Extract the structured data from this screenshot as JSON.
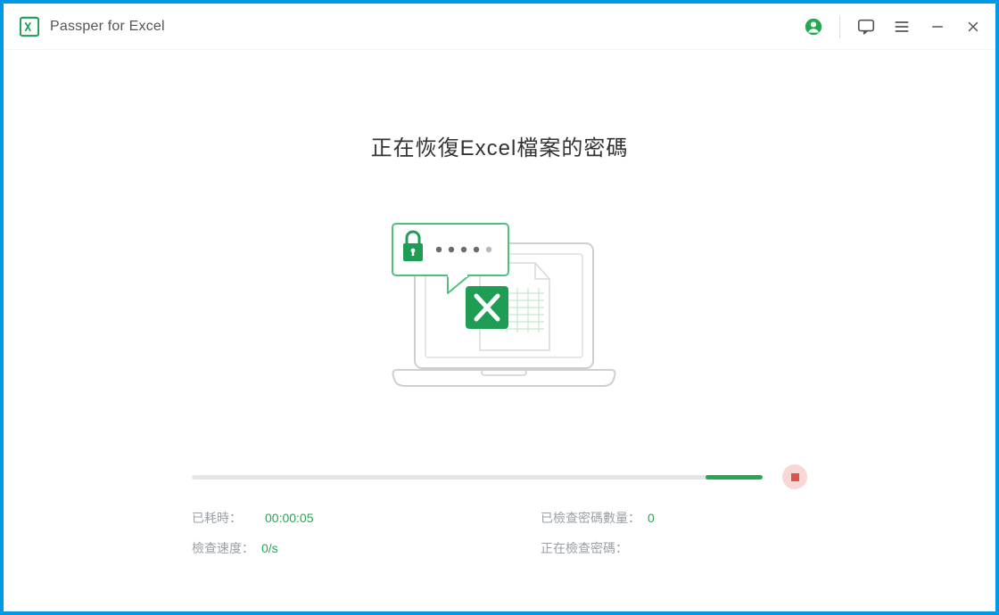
{
  "app": {
    "title": "Passper for Excel"
  },
  "main": {
    "heading": "正在恢復Excel檔案的密碼"
  },
  "progress": {
    "percent": 10
  },
  "stats": {
    "elapsed_label": "已耗時：",
    "elapsed_value": "00:00:05",
    "speed_label": "檢查速度：",
    "speed_value": "0/s",
    "checked_label": "已檢查密碼數量：",
    "checked_value": "0",
    "current_label": "正在檢查密碼：",
    "current_value": ""
  },
  "colors": {
    "brand_green": "#22a94f",
    "window_border": "#0099e5",
    "stop_red": "#d9534f"
  }
}
